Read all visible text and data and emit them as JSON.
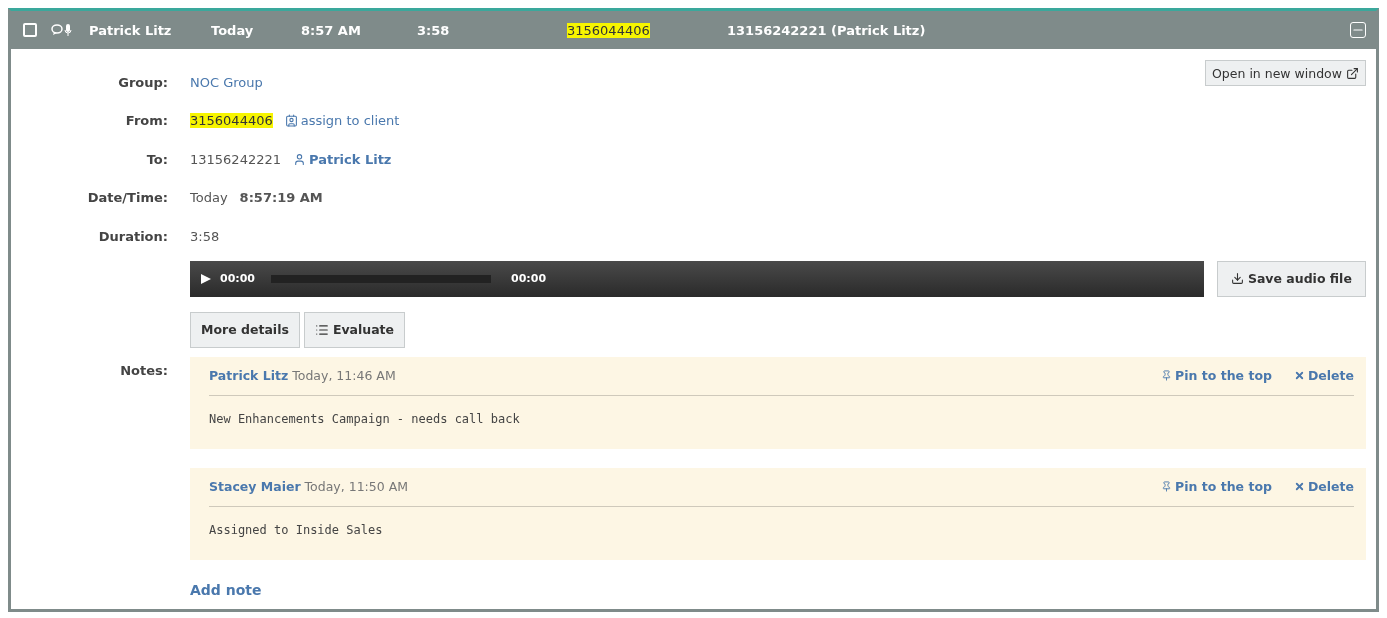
{
  "header": {
    "checked": false,
    "name": "Patrick Litz",
    "day": "Today",
    "time": "8:57 AM",
    "duration": "3:58",
    "from": "3156044406",
    "to": "13156242221 (Patrick Litz)"
  },
  "open_button": "Open in new window",
  "fields": [
    {
      "kind": "link",
      "label": "Group:",
      "value": "NOC Group"
    },
    {
      "kind": "from",
      "label": "From:",
      "value": "3156044406",
      "action": "assign to client"
    },
    {
      "kind": "to",
      "label": "To:",
      "value": "13156242221",
      "contact": "Patrick Litz"
    },
    {
      "kind": "datetime",
      "label": "Date/Time:",
      "value": "Today",
      "time": "8:57:19 AM"
    },
    {
      "kind": "plain",
      "label": "Duration:",
      "value": "3:58"
    }
  ],
  "player": {
    "current": "00:00",
    "total": "00:00"
  },
  "save_button": "Save audio file",
  "buttons": [
    {
      "kind": "plain",
      "label": "More details"
    },
    {
      "kind": "list",
      "label": "Evaluate"
    }
  ],
  "notes_label": "Notes:",
  "notes": [
    {
      "author": "Patrick Litz",
      "time": "Today, 11:46 AM",
      "pin": "Pin to the top",
      "delete": "Delete",
      "text": "New Enhancements Campaign - needs call back"
    },
    {
      "author": "Stacey Maier",
      "time": "Today, 11:50 AM",
      "pin": "Pin to the top",
      "delete": "Delete",
      "text": "Assigned to Inside Sales"
    }
  ],
  "add_note": "Add note"
}
